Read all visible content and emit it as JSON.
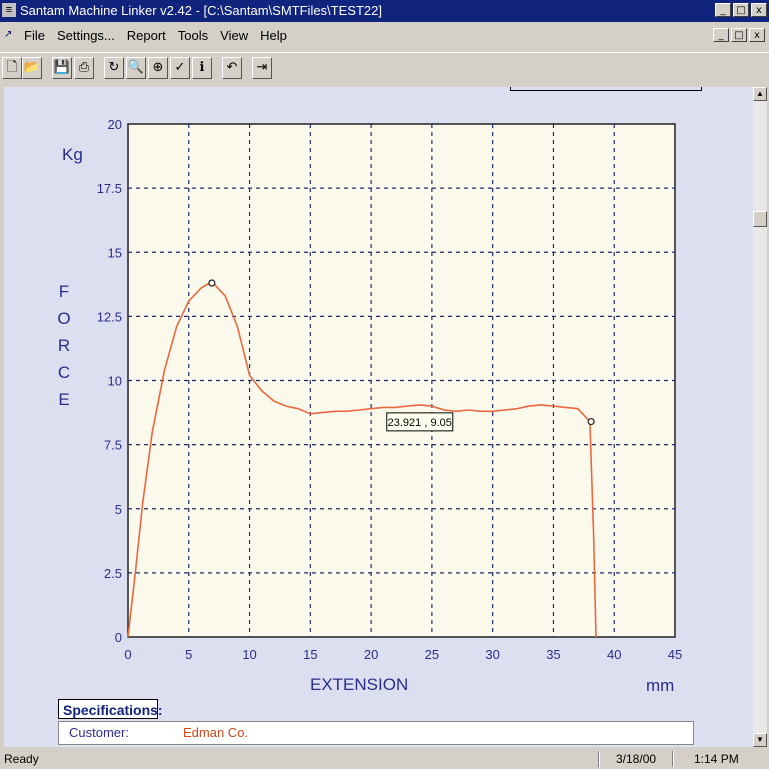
{
  "window": {
    "title": "Santam Machine Linker v2.42 - [C:\\Santam\\SMTFiles\\TEST22]",
    "app_icon": "santam-app-icon",
    "controls": [
      "_",
      "□",
      "x"
    ]
  },
  "menu": {
    "items": [
      "File",
      "Settings...",
      "Report",
      "Tools",
      "View",
      "Help"
    ]
  },
  "toolbar": {
    "buttons": [
      {
        "name": "new-icon",
        "glyph": "🗋"
      },
      {
        "name": "open-icon",
        "glyph": "📂"
      },
      {
        "name": "save-icon",
        "glyph": "💾"
      },
      {
        "name": "print-icon",
        "glyph": "⎙"
      },
      {
        "name": "reload-icon",
        "glyph": "↻"
      },
      {
        "name": "print-preview-icon",
        "glyph": "🔍"
      },
      {
        "name": "crosshair-icon",
        "glyph": "⊕"
      },
      {
        "name": "check-icon",
        "glyph": "✓"
      },
      {
        "name": "info-icon",
        "glyph": "ℹ"
      },
      {
        "name": "undo-icon",
        "glyph": "↶"
      },
      {
        "name": "export-icon",
        "glyph": "⇥"
      }
    ]
  },
  "chart_data": {
    "type": "line",
    "title": "",
    "unit_y": "Kg",
    "ylabel": "FORCE",
    "xlabel": "EXTENSION",
    "unit_x": "mm",
    "xlim": [
      0,
      45
    ],
    "ylim": [
      0,
      20
    ],
    "xticks": [
      "0",
      "5",
      "10",
      "15",
      "20",
      "25",
      "30",
      "35",
      "40",
      "45"
    ],
    "yticks": [
      "0",
      "2.5",
      "5",
      "7.5",
      "10",
      "12.5",
      "15",
      "17.5",
      "20"
    ],
    "grid": true,
    "series": [
      {
        "color": "#e8693e",
        "x": [
          0,
          0.6,
          1.2,
          2,
          3,
          4,
          5,
          6,
          6.5,
          7,
          8,
          9,
          10,
          11,
          12,
          13,
          14,
          15,
          16,
          17,
          18,
          19,
          20,
          21,
          22,
          23,
          24,
          25,
          26,
          27,
          28,
          29,
          30,
          31,
          32,
          33,
          34,
          35,
          36,
          37,
          38,
          38.3,
          38.5
        ],
        "y": [
          0,
          2.5,
          5.2,
          8,
          10.4,
          12.1,
          13.1,
          13.6,
          13.75,
          13.8,
          13.3,
          12.1,
          10.2,
          9.6,
          9.2,
          9.0,
          8.9,
          8.7,
          8.75,
          8.8,
          8.8,
          8.85,
          8.9,
          8.95,
          8.95,
          9.0,
          9.05,
          9.0,
          8.85,
          8.8,
          8.85,
          8.8,
          8.8,
          8.85,
          8.9,
          9.0,
          9.05,
          9.0,
          8.95,
          8.9,
          8.4,
          4.0,
          0
        ]
      }
    ],
    "markers": [
      {
        "x": 6.9,
        "y": 13.8
      },
      {
        "x": 38.1,
        "y": 8.4
      }
    ],
    "readout": {
      "x": 23.921,
      "y": 9.05,
      "text": "23.921 , 9.05"
    }
  },
  "specs": {
    "label": "Specifications:",
    "customer_label": "Customer:",
    "customer_value": "Edman Co."
  },
  "status": {
    "text": "Ready",
    "date": "3/18/00",
    "time": "1:14 PM"
  }
}
